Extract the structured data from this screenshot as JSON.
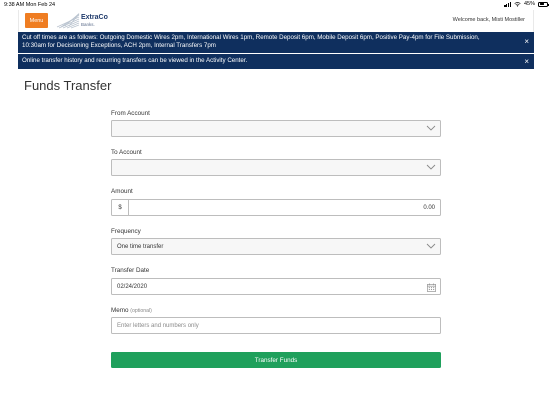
{
  "status_bar": {
    "time_date": "9:38 AM   Mon Feb 24",
    "battery": "45%"
  },
  "header": {
    "menu_label": "Menu",
    "logo_name": "ExtraCo",
    "logo_sub": "Banks.",
    "welcome": "Welcome back, Misti Mostiller"
  },
  "alerts": [
    {
      "text": "Cut off times are as follows: Outgoing Domestic Wires 2pm, International Wires 1pm, Remote Deposit 6pm, Mobile Deposit 6pm, Positive Pay-4pm for File Submission, 10:30am for Decisioning Exceptions, ACH 2pm, Internal Transfers 7pm",
      "close": "×"
    },
    {
      "text": "Online transfer history and recurring transfers can be viewed in the Activity Center.",
      "close": "×"
    }
  ],
  "page_title": "Funds Transfer",
  "form": {
    "from_account": {
      "label": "From Account",
      "value": ""
    },
    "to_account": {
      "label": "To Account",
      "value": ""
    },
    "amount": {
      "label": "Amount",
      "prefix": "$",
      "value": "0.00"
    },
    "frequency": {
      "label": "Frequency",
      "value": "One time transfer"
    },
    "transfer_date": {
      "label": "Transfer Date",
      "value": "02/24/2020"
    },
    "memo": {
      "label": "Memo",
      "optional": "(optional)",
      "placeholder": "Enter letters and numbers only"
    },
    "submit_label": "Transfer Funds"
  },
  "colors": {
    "menu_button": "#ef7d22",
    "alert_bg": "#0f2f5e",
    "submit_bg": "#1fa05c"
  }
}
